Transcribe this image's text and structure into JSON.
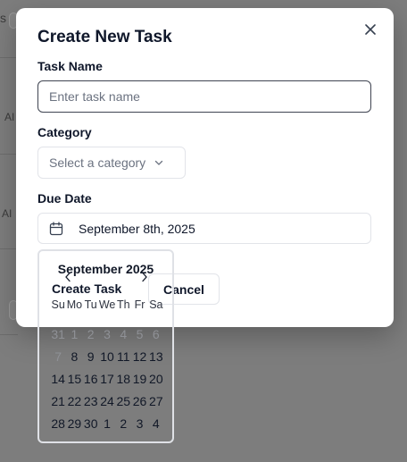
{
  "background": {
    "fragments": [
      "s",
      "AI",
      "AI"
    ]
  },
  "dialog": {
    "title": "Create New Task",
    "close_icon": "close-icon",
    "task_name": {
      "label": "Task Name",
      "value": "",
      "placeholder": "Enter task name"
    },
    "category": {
      "label": "Category",
      "placeholder": "Select a category",
      "icon": "chevron-down-icon"
    },
    "due_date": {
      "label": "Due Date",
      "value": "September 8th, 2025",
      "icon": "calendar-icon"
    },
    "actions": {
      "create_label": "Create Task",
      "cancel_label": "Cancel"
    }
  },
  "calendar": {
    "caption": "September 2025",
    "prev_icon": "chevron-left-icon",
    "next_icon": "chevron-right-icon",
    "weekdays": [
      "Su",
      "Mo",
      "Tu",
      "We",
      "Th",
      "Fr",
      "Sa"
    ],
    "weeks": [
      [
        "31",
        "1",
        "2",
        "3",
        "4",
        "5",
        "6"
      ],
      [
        "7",
        "8",
        "9",
        "10",
        "11",
        "12",
        "13"
      ],
      [
        "14",
        "15",
        "16",
        "17",
        "18",
        "19",
        "20"
      ],
      [
        "21",
        "22",
        "23",
        "24",
        "25",
        "26",
        "27"
      ],
      [
        "28",
        "29",
        "30",
        "1",
        "2",
        "3",
        "4"
      ]
    ],
    "disabled_days": [
      "31",
      "1",
      "2",
      "3",
      "4",
      "5",
      "6",
      "7"
    ],
    "outside_color": "#8f9196"
  },
  "colors": {
    "overlay": "#7d7d7d",
    "surface": "#ffffff",
    "text": "#0f172a",
    "muted": "#6b7280",
    "border": "#e2e4e9"
  }
}
